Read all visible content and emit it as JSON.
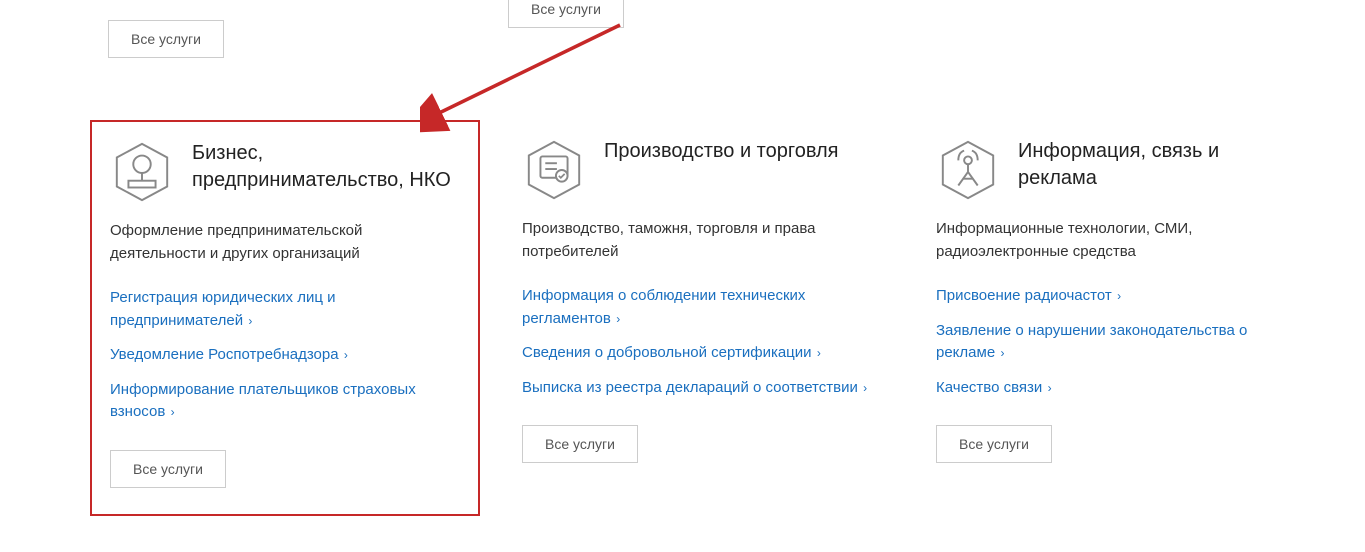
{
  "allServicesLabel": "Все услуги",
  "cards": [
    {
      "title": "Бизнес, предпринимательство, НКО",
      "subtitle": "Оформление предпринимательской деятельности и других организаций",
      "links": [
        "Регистрация юридических лиц и предпринимателей",
        "Уведомление Роспотребнадзора",
        "Информирование плательщиков страховых взносов"
      ]
    },
    {
      "title": "Производство и торговля",
      "subtitle": "Производство, таможня, торговля и права потребителей",
      "links": [
        "Информация о соблюдении технических регламентов",
        "Сведения о добровольной сертификации",
        "Выписка из реестра деклараций о соответствии"
      ]
    },
    {
      "title": "Информация, связь и реклама",
      "subtitle": "Информационные технологии, СМИ, радиоэлектронные средства",
      "links": [
        "Присвоение радиочастот",
        "Заявление о нарушении законодательства о рекламе",
        "Качество связи"
      ]
    }
  ]
}
